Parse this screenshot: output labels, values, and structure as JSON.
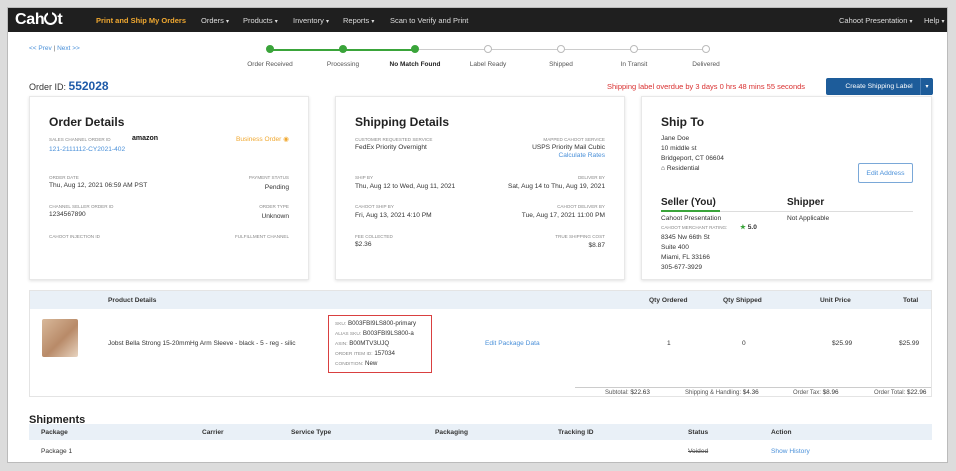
{
  "nav": {
    "logo": "Cahoot",
    "brand": "Print and Ship My Orders",
    "items": [
      "Orders",
      "Products",
      "Inventory",
      "Reports"
    ],
    "scan": "Scan to Verify and Print",
    "account": "Cahoot Presentation",
    "help": "Help"
  },
  "prevnext": {
    "prev": "<< Prev",
    "sep": "|",
    "next": "Next >>"
  },
  "progress": {
    "steps": [
      "Order Received",
      "Processing",
      "No Match Found",
      "Label Ready",
      "Shipped",
      "In Transit",
      "Delivered"
    ],
    "completed_steps": 3,
    "current": "No Match Found"
  },
  "order": {
    "id_label": "Order ID:",
    "id": "552028",
    "overdue": "Shipping label overdue by 3 days 0 hrs 48 mins 55 seconds",
    "create_label": "Create Shipping Label"
  },
  "order_details": {
    "title": "Order Details",
    "sco_label": "SALES CHANNEL ORDER ID",
    "channel": "amazon",
    "sco_value": "121-2111112-CY2021-402",
    "business_order": "Business Order",
    "date_label": "ORDER DATE",
    "date": "Thu, Aug 12, 2021 06:59 AM PST",
    "pay_label": "PAYMENT STATUS",
    "pay": "Pending",
    "seller_label": "CHANNEL SELLER ORDER ID",
    "seller": "1234567890",
    "type_label": "ORDER TYPE",
    "type": "Unknown",
    "inj_label": "CAHOOT INJECTION ID",
    "ful_label": "FULFILLMENT CHANNEL"
  },
  "shipping_details": {
    "title": "Shipping Details",
    "crs_label": "CUSTOMER REQUESTED SERVICE",
    "crs": "FedEx Priority Overnight",
    "mcs_label": "MAPPED CAHOOT SERVICE",
    "mcs": "USPS Priority Mail Cubic",
    "calc": "Calculate Rates",
    "shipby_label": "SHIP BY",
    "shipby": "Thu, Aug 12 to Wed, Aug 11, 2021",
    "delby_label": "DELIVER BY",
    "delby": "Sat, Aug 14 to Thu, Aug 19, 2021",
    "cshipby_label": "CAHOOT SHIP BY",
    "cshipby": "Fri, Aug 13, 2021 4:10 PM",
    "cdelby_label": "CAHOOT DELIVER BY",
    "cdelby": "Tue, Aug 17, 2021 11:00 PM",
    "fee_label": "FEE COLLECTED",
    "fee": "$2.36",
    "true_label": "TRUE SHIPPING COST",
    "true": "$8.87"
  },
  "ship_to": {
    "title": "Ship To",
    "name": "Jane Doe",
    "addr1": "10 middle st",
    "addr2": "Bridgeport, CT 06604",
    "res": "Residential",
    "edit": "Edit Address",
    "seller_title": "Seller (You)",
    "shipper_title": "Shipper",
    "seller_name": "Cahoot Presentation",
    "rating_label": "CAHOOT MERCHANT RATING:",
    "rating": "5.0",
    "s1": "8345 Nw 66th St",
    "s2": "Suite 400",
    "s3": "Miami, FL 33166",
    "s4": "305-677-3929",
    "shipper_value": "Not Applicable"
  },
  "products": {
    "headers": [
      "Product Details",
      "Qty Ordered",
      "Qty Shipped",
      "Unit Price",
      "Total"
    ],
    "name": "Jobst Bella Strong 15-20mmHg Arm Sleeve - black - 5 - reg - silic",
    "sku_l": "SKU:",
    "sku": "B003FBI9LS800-primary",
    "alias_l": "ALIAS SKU:",
    "alias": "B003FBI9LS800-a",
    "asin_l": "ASIN:",
    "asin": "B00MTV3UJQ",
    "oi_l": "ORDER ITEM ID:",
    "oi": "157034",
    "cond_l": "CONDITION:",
    "cond": "New",
    "edit_pkg": "Edit Package Data",
    "qty_ordered": "1",
    "qty_shipped": "0",
    "unit": "$25.99",
    "total": "$25.99",
    "subtotal_l": "Subtotal:",
    "subtotal": "$22.63",
    "sh_l": "Shipping & Handling:",
    "sh": "$4.36",
    "tax_l": "Order Tax:",
    "tax": "$8.96",
    "ot_l": "Order Total:",
    "ot": "$22.96"
  },
  "shipments": {
    "title": "Shipments",
    "headers": [
      "Package",
      "Carrier",
      "Service Type",
      "Packaging",
      "Tracking ID",
      "Status",
      "Action"
    ],
    "package": "Package 1",
    "status": "Voided",
    "action": "Show History"
  },
  "colors": {
    "accent": "#1d5c9a",
    "brand": "#f0a830",
    "alert": "#d93030",
    "success": "#3aa43a",
    "link": "#4a90d9"
  }
}
